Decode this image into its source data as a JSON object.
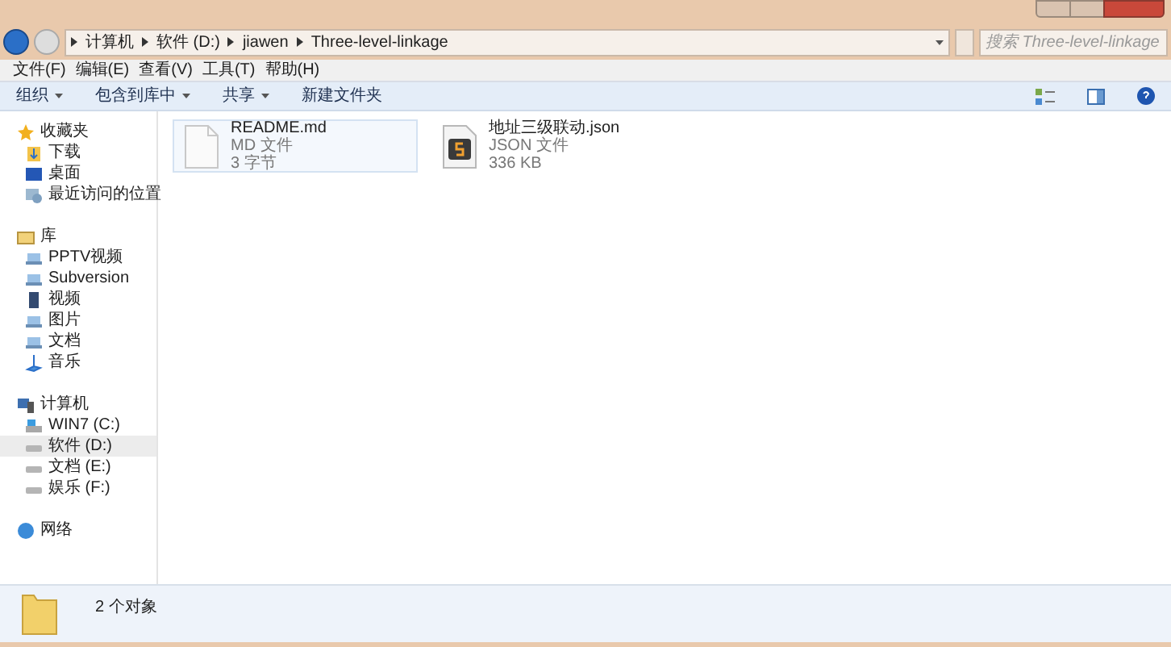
{
  "address_bar": {
    "crumbs": [
      "计算机",
      "软件 (D:)",
      "jiawen",
      "Three-level-linkage"
    ]
  },
  "search": {
    "placeholder": "搜索 Three-level-linkage"
  },
  "menu": [
    "文件(F)",
    "编辑(E)",
    "查看(V)",
    "工具(T)",
    "帮助(H)"
  ],
  "toolbar": [
    {
      "label": "组织",
      "dropdown": true
    },
    {
      "label": "包含到库中",
      "dropdown": true
    },
    {
      "label": "共享",
      "dropdown": true
    },
    {
      "label": "新建文件夹",
      "dropdown": false
    }
  ],
  "sidebar": [
    {
      "label": "收藏夹",
      "kind": "star",
      "children": [
        {
          "label": "下载",
          "kind": "download",
          "selected": false
        },
        {
          "label": "桌面",
          "kind": "desktop",
          "selected": false
        },
        {
          "label": "最近访问的位置",
          "kind": "recent",
          "selected": false
        }
      ]
    },
    {
      "label": "库",
      "kind": "library",
      "children": [
        {
          "label": "PPTV视频",
          "kind": "lib",
          "selected": false
        },
        {
          "label": "Subversion",
          "kind": "lib",
          "selected": false
        },
        {
          "label": "视频",
          "kind": "video",
          "selected": false
        },
        {
          "label": "图片",
          "kind": "lib",
          "selected": false
        },
        {
          "label": "文档",
          "kind": "lib",
          "selected": false
        },
        {
          "label": "音乐",
          "kind": "music",
          "selected": false
        }
      ]
    },
    {
      "label": "计算机",
      "kind": "computer",
      "children": [
        {
          "label": "WIN7 (C:)",
          "kind": "sysdrive",
          "selected": false
        },
        {
          "label": "软件 (D:)",
          "kind": "drive",
          "selected": true
        },
        {
          "label": "文档 (E:)",
          "kind": "drive",
          "selected": false
        },
        {
          "label": "娱乐 (F:)",
          "kind": "drive",
          "selected": false
        }
      ]
    },
    {
      "label": "网络",
      "kind": "network"
    }
  ],
  "files": [
    {
      "name": "README.md",
      "type": "MD 文件",
      "size": "3 字节",
      "kind": "blank",
      "selected": true
    },
    {
      "name": "地址三级联动.json",
      "type": "JSON 文件",
      "size": "336 KB",
      "kind": "script",
      "selected": false
    }
  ],
  "status_bar": {
    "count": "2 个对象"
  }
}
